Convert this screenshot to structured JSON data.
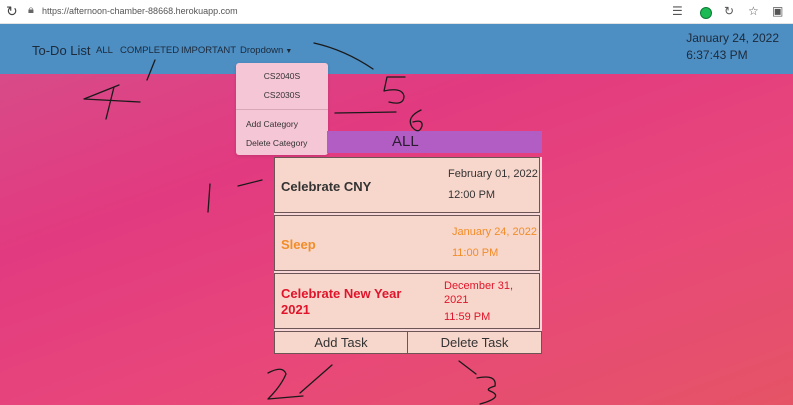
{
  "browser": {
    "url": "https://afternoon-chamber-88668.herokuapp.com"
  },
  "navbar": {
    "brand": "To-Do List",
    "links": [
      "ALL",
      "COMPLETED",
      "IMPORTANT",
      "Dropdown"
    ],
    "date": "January 24, 2022",
    "time": "6:37:43 PM"
  },
  "dropdown": {
    "categories": [
      "CS2040S",
      "CS2030S"
    ],
    "actions": [
      "Add Category",
      "Delete Category"
    ]
  },
  "panel": {
    "header": "ALL",
    "tasks": [
      {
        "title": "Celebrate CNY",
        "date": "February 01, 2022",
        "time": "12:00 PM",
        "color": "#333333"
      },
      {
        "title": "Sleep",
        "date": "January 24, 2022",
        "time": "11:00 PM",
        "color": "#f28c28"
      },
      {
        "title": "Celebrate New Year 2021",
        "date": "December 31, 2021",
        "time": "11:59 PM",
        "color": "#e0142a"
      }
    ],
    "add_label": "Add Task",
    "delete_label": "Delete Task"
  },
  "annotations": [
    "1",
    "2",
    "3",
    "4",
    "5",
    "6"
  ],
  "colors": {
    "navbar": "#4d8ec3",
    "header": "#b25dc3",
    "task_bg": "#f7d7cc"
  }
}
